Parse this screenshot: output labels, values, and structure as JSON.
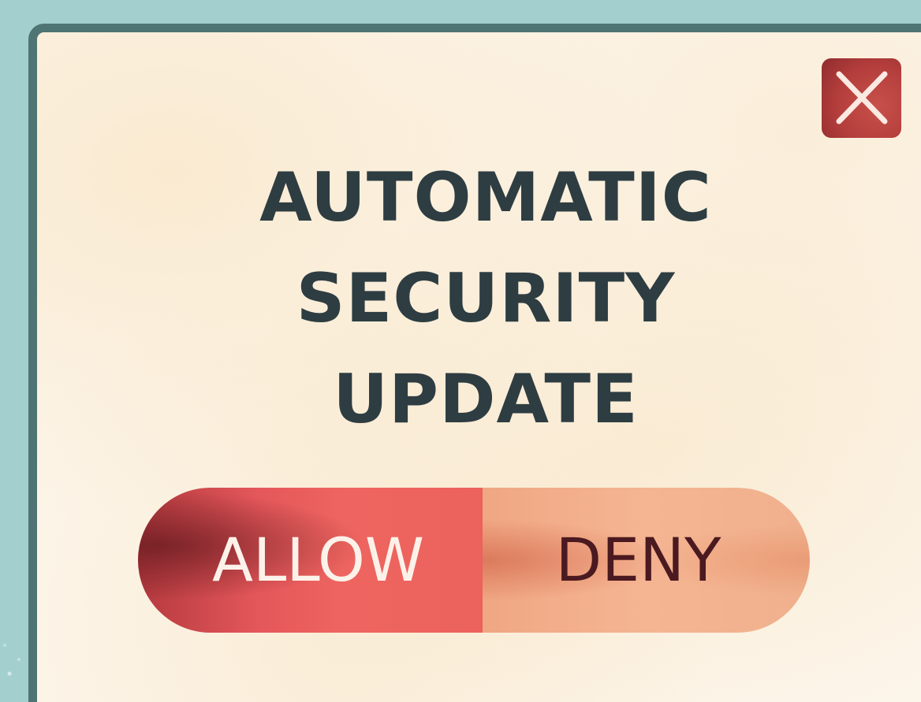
{
  "dialog": {
    "title_lines": [
      "AUTOMATIC",
      "SECURITY",
      "UPDATE"
    ],
    "close_icon": "close-icon",
    "toggle": {
      "allow_label": "ALLOW",
      "deny_label": "DENY",
      "selected": "ALLOW"
    }
  },
  "colors": {
    "desktop_background": "#a3cfcf",
    "dialog_border": "#4e7474",
    "dialog_background": "#fcf5ea",
    "title_text": "#2e3d42",
    "close_button": "#b43e3c",
    "allow_background": "#ec625c",
    "deny_background": "#f5b592",
    "deny_text": "#4a1a20"
  }
}
